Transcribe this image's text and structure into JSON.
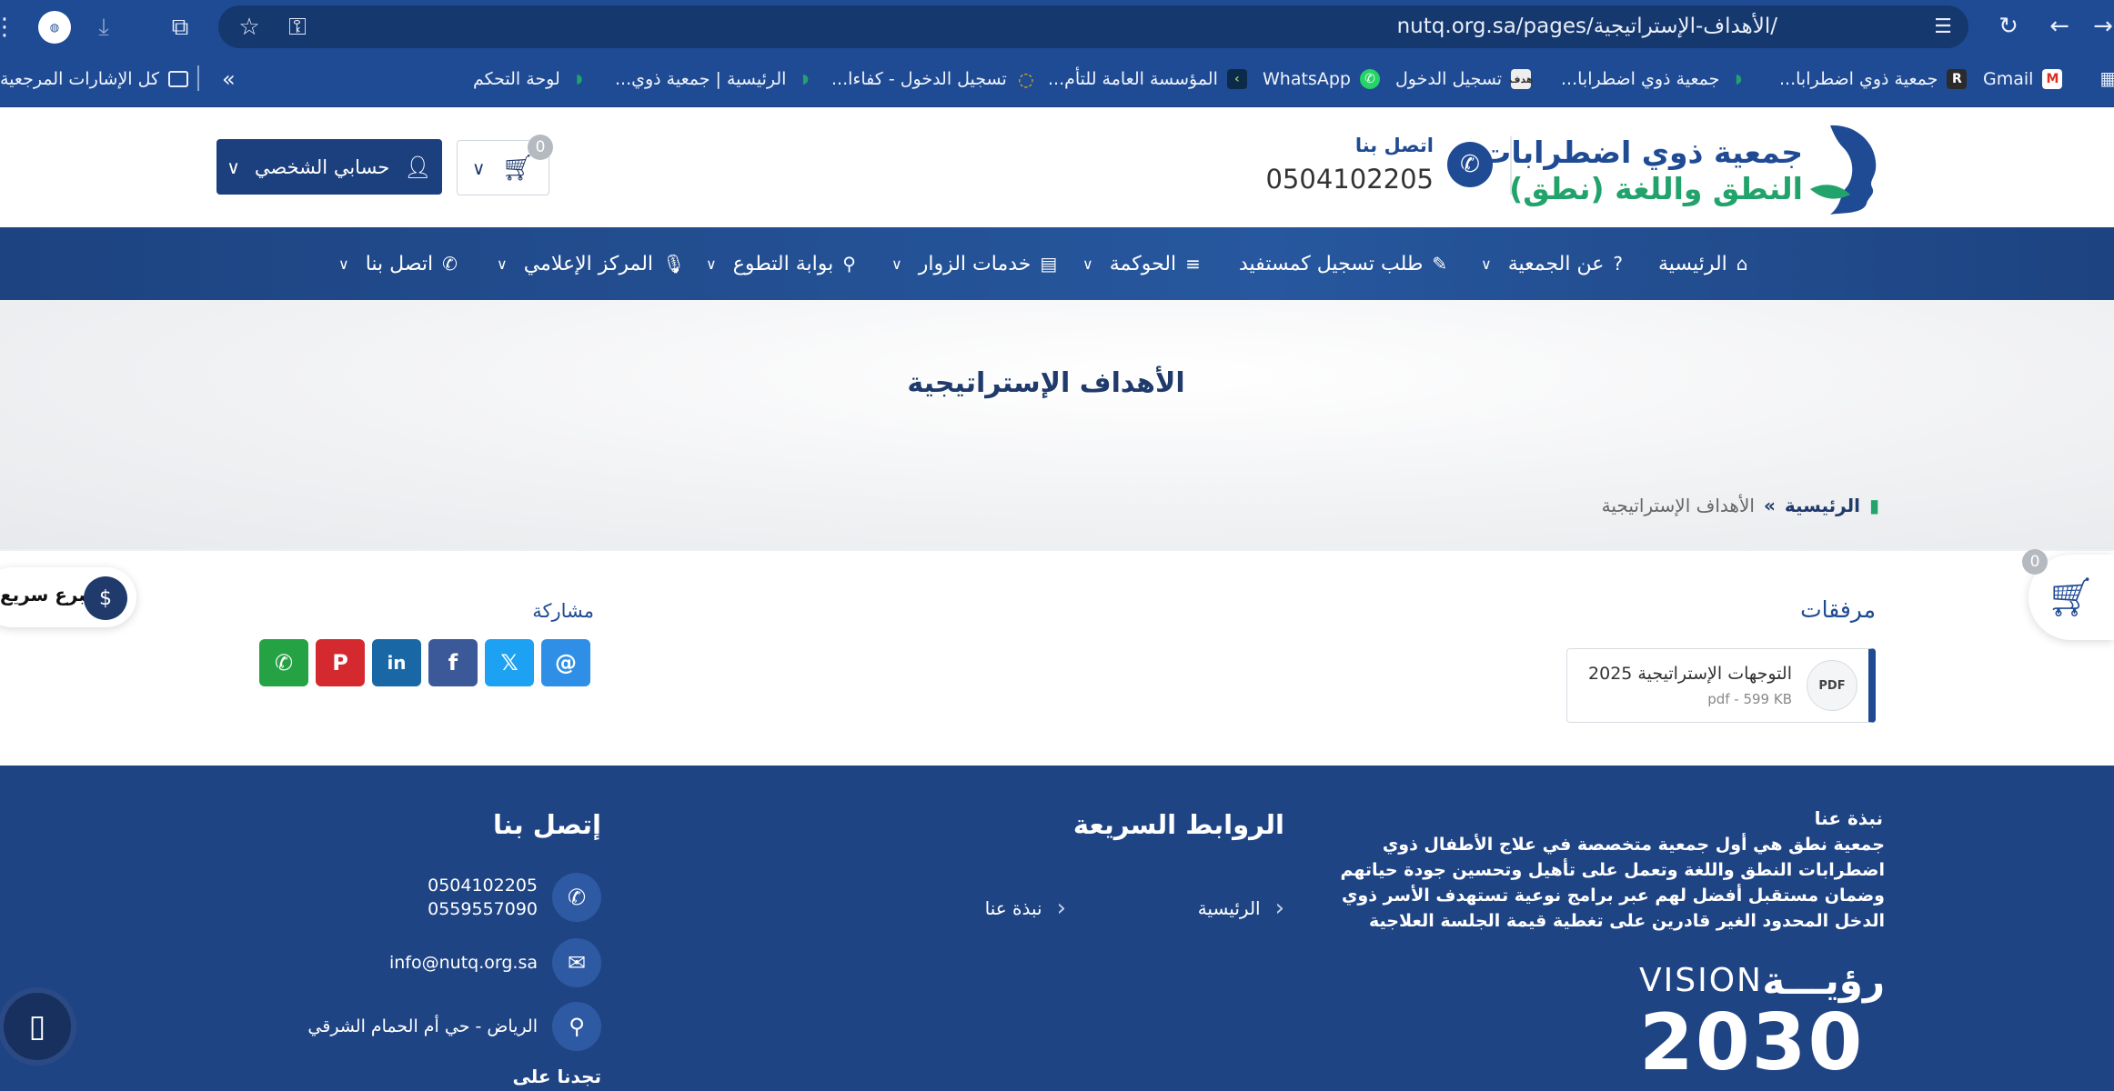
{
  "browser": {
    "url": "nutq.org.sa/pages/الأهداف-الإستراتيجية/",
    "bookmarks": [
      {
        "label": "Gmail",
        "icon": "gmail-icon"
      },
      {
        "label": "جمعية ذوي اضطرابا...",
        "icon": "r-icon"
      },
      {
        "label": "جمعية ذوي اضطرابا...",
        "icon": "nutq-icon"
      },
      {
        "label": "تسجيل الدخول",
        "icon": "hadaf-icon"
      },
      {
        "label": "WhatsApp",
        "icon": "whatsapp-icon"
      },
      {
        "label": "المؤسسة العامة للتأم...",
        "icon": "gosi-icon"
      },
      {
        "label": "تسجيل الدخول - كفاءا...",
        "icon": "kafaat-icon"
      },
      {
        "label": "الرئيسية | جمعية ذوي...",
        "icon": "nutq-icon"
      },
      {
        "label": "لوحة التحكم",
        "icon": "nutq-icon"
      }
    ],
    "more_bookmarks": "»",
    "all_bookmarks": "كل الإشارات المرجعية"
  },
  "header": {
    "logo_line1": "جمعية ذوي اضطرابات",
    "logo_line2": "النطق واللغة (نطق)",
    "contact_label": "اتصل بنا",
    "contact_phone": "0504102205",
    "cart_count": "0",
    "account_label": "حسابي الشخصي"
  },
  "nav": {
    "items": [
      {
        "label": "الرئيسية",
        "icon": "home-icon",
        "dropdown": false
      },
      {
        "label": "عن الجمعية",
        "icon": "question-icon",
        "dropdown": true
      },
      {
        "label": "طلب تسجيل كمستفيد",
        "icon": "edit-icon",
        "dropdown": false
      },
      {
        "label": "الحوكمة",
        "icon": "list-icon",
        "dropdown": true
      },
      {
        "label": "خدمات الزوار",
        "icon": "id-card-icon",
        "dropdown": true
      },
      {
        "label": "بوابة التطوع",
        "icon": "person-icon",
        "dropdown": true
      },
      {
        "label": "المركز الإعلامي",
        "icon": "microphone-icon",
        "dropdown": true
      },
      {
        "label": "اتصل بنا",
        "icon": "phone-icon",
        "dropdown": true
      }
    ]
  },
  "hero": {
    "title": "الأهداف الإستراتيجية",
    "breadcrumb_home": "الرئيسية",
    "breadcrumb_sep": "»",
    "breadcrumb_current": "الأهداف الإستراتيجية"
  },
  "content": {
    "attachments_label": "مرفقات",
    "attachment_name": "التوجهات الإستراتيجية 2025",
    "attachment_meta": "pdf - 599 KB",
    "pdf_badge": "PDF",
    "share_label": "مشاركة",
    "share_buttons": [
      {
        "name": "whatsapp",
        "color": "#25a244"
      },
      {
        "name": "pinterest",
        "color": "#d42a2f"
      },
      {
        "name": "linkedin",
        "color": "#1a67a5"
      },
      {
        "name": "facebook",
        "color": "#3b5998"
      },
      {
        "name": "x",
        "color": "#1da1f2"
      },
      {
        "name": "email",
        "color": "#2f8fe6"
      }
    ]
  },
  "floating": {
    "donate_label": "تبرع سريع",
    "cart_count": "0"
  },
  "footer": {
    "about_title": "نبذة عنا",
    "about_text": "جمعية نطق هي أول جمعية متخصصة في علاج الأطفال ذوي اضطرابات النطق واللغة وتعمل على تأهيل وتحسين جودة حياتهم وضمان مستقبل أفضل لهم عبر برامج نوعية تستهدف الأسر ذوي الدخل المحدود الغير قادرين على تغطية قيمة الجلسة العلاجية",
    "links_title": "الروابط السريعة",
    "links": [
      "الرئيسية",
      "نبذة عنا"
    ],
    "contact_title": "إتصل بنا",
    "phone1": "0504102205",
    "phone2": "0559557090",
    "email": "info@nutq.org.sa",
    "address": "الرياض - حي أم الحمام الشرقي",
    "find_us": "تجدنا على",
    "vision_ar": "رؤيـــة",
    "vision_en": "VISION",
    "vision_num": "2030"
  },
  "colors": {
    "primary": "#1f4b94",
    "accent_green": "#22a36b",
    "footer_bg": "#1f4484"
  }
}
